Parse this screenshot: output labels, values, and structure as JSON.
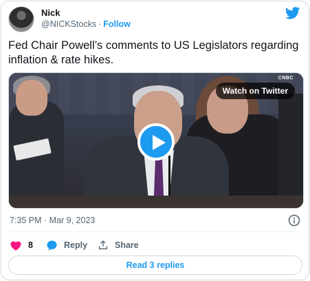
{
  "author": {
    "name": "Nick",
    "handle": "@NICKStocks",
    "separator": "·",
    "follow_label": "Follow"
  },
  "tweet": {
    "text": "Fed Chair Powell’s comments to US Legislators regarding inflation & rate hikes.",
    "timestamp": "7:35 PM · Mar 9, 2023"
  },
  "media": {
    "watch_label": "Watch on Twitter",
    "channel_logo_text": "CNBC"
  },
  "actions": {
    "like_count": "8",
    "reply_label": "Reply",
    "share_label": "Share",
    "read_replies_label": "Read 3 replies"
  },
  "colors": {
    "accent": "#1d9bf0",
    "like": "#f91880",
    "muted_text": "#536471",
    "text": "#0f1419",
    "border": "#cfd9de"
  },
  "icons": [
    "twitter-bird-icon",
    "play-icon",
    "info-icon",
    "heart-icon",
    "reply-bubble-icon",
    "share-icon"
  ]
}
